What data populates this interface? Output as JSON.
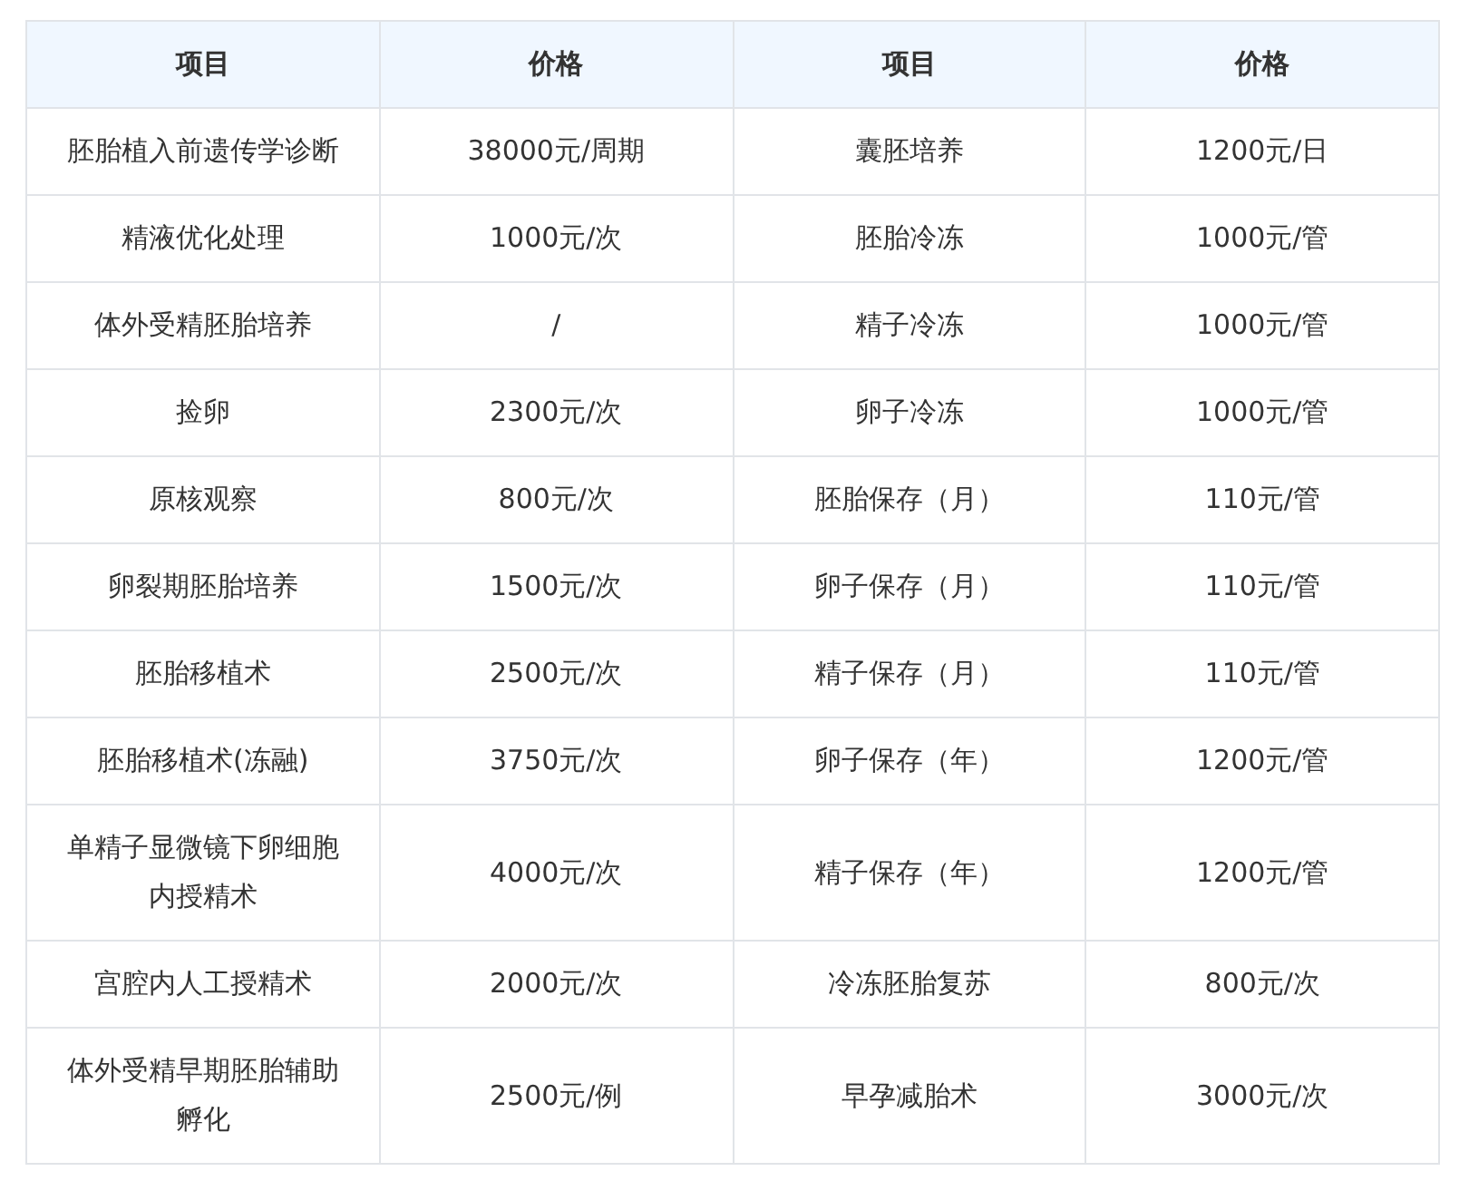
{
  "table": {
    "columns": [
      "项目",
      "价格",
      "项目",
      "价格"
    ],
    "rows": [
      [
        "胚胎植入前遗传学诊断",
        "38000元/周期",
        "囊胚培养",
        "1200元/日"
      ],
      [
        "精液优化处理",
        "1000元/次",
        "胚胎冷冻",
        "1000元/管"
      ],
      [
        "体外受精胚胎培养",
        "/",
        "精子冷冻",
        "1000元/管"
      ],
      [
        "捡卵",
        "2300元/次",
        "卵子冷冻",
        "1000元/管"
      ],
      [
        "原核观察",
        "800元/次",
        "胚胎保存（月）",
        "110元/管"
      ],
      [
        "卵裂期胚胎培养",
        "1500元/次",
        "卵子保存（月）",
        "110元/管"
      ],
      [
        "胚胎移植术",
        "2500元/次",
        "精子保存（月）",
        "110元/管"
      ],
      [
        "胚胎移植术(冻融)",
        "3750元/次",
        "卵子保存（年）",
        "1200元/管"
      ],
      [
        "单精子显微镜下卵细胞内授精术",
        "4000元/次",
        "精子保存（年）",
        "1200元/管"
      ],
      [
        "宫腔内人工授精术",
        "2000元/次",
        "冷冻胚胎复苏",
        "800元/次"
      ],
      [
        "体外受精早期胚胎辅助孵化",
        "2500元/例",
        "早孕减胎术",
        "3000元/次"
      ]
    ]
  }
}
